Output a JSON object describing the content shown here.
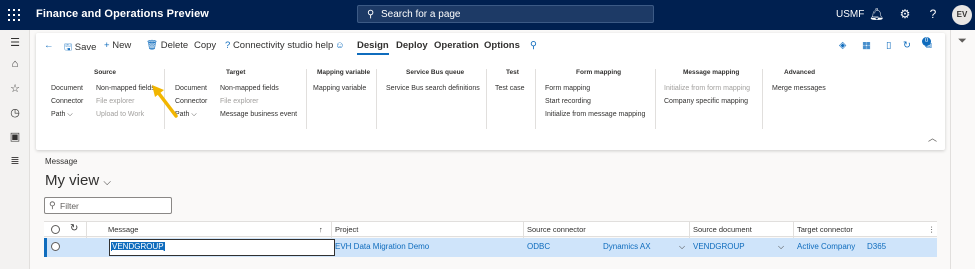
{
  "topbar": {
    "app_title": "Finance and Operations Preview",
    "search_placeholder": "Search for a page",
    "company": "USMF",
    "avatar_initials": "EV",
    "bg_color": "#002050"
  },
  "toolbar": {
    "save": "Save",
    "new": "New",
    "delete": "Delete",
    "copy": "Copy",
    "connectivity_help": "Connectivity studio help",
    "tabs": [
      "Design",
      "Deploy",
      "Operation",
      "Options"
    ],
    "selected_tab": "Design",
    "attachments_count": "0"
  },
  "ribbon": {
    "source": {
      "header": "Source",
      "document": "Document",
      "connector": "Connector",
      "path": "Path",
      "non_mapped_fields": "Non-mapped fields",
      "file_explorer": "File explorer",
      "upload_to_work": "Upload to Work"
    },
    "target": {
      "header": "Target",
      "document": "Document",
      "connector": "Connector",
      "path": "Path",
      "non_mapped_fields": "Non-mapped fields",
      "file_explorer": "File explorer",
      "message_business_event": "Message business event"
    },
    "mapping_variable": {
      "header": "Mapping variable",
      "item": "Mapping variable"
    },
    "service_bus_queue": {
      "header": "Service Bus queue",
      "item": "Service Bus search definitions"
    },
    "test": {
      "header": "Test",
      "item": "Test case"
    },
    "form_mapping": {
      "header": "Form mapping",
      "form_mapping": "Form mapping",
      "start_recording": "Start recording",
      "initialize_from_message_mapping": "Initialize from message mapping"
    },
    "message_mapping": {
      "header": "Message mapping",
      "initialize_from_form_mapping": "Initialize from form mapping",
      "company_specific_mapping": "Company specific mapping"
    },
    "advanced": {
      "header": "Advanced",
      "merge_messages": "Merge messages"
    }
  },
  "page": {
    "section_label": "Message",
    "view_name": "My view",
    "filter_placeholder": "Filter"
  },
  "grid": {
    "columns": [
      "Message",
      "Project",
      "Source connector",
      "Source document",
      "Target connector"
    ],
    "sort_indicator": "↑",
    "rows": [
      {
        "message": "VENDGROUP",
        "project": "EVH Data Migration Demo",
        "source_connector_type": "ODBC",
        "source_connector_name": "Dynamics AX",
        "source_document": "VENDGROUP",
        "target_connector_name": "Active Company",
        "target_connector_type": "D365"
      }
    ]
  },
  "colors": {
    "accent": "#0f6cbd",
    "selected_row": "#cfe4fa",
    "annotation_arrow": "#f2b600"
  }
}
